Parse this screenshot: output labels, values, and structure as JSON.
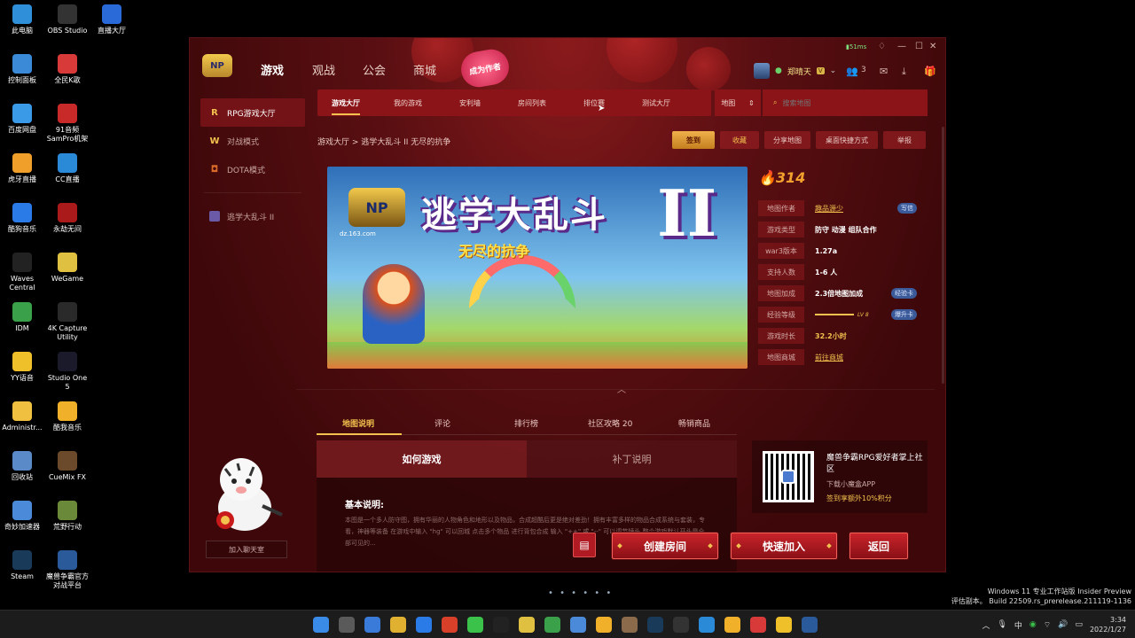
{
  "desktop": {
    "icons": [
      {
        "label": "此电脑",
        "icon": "computer-icon",
        "color": "#2f8fd8"
      },
      {
        "label": "OBS Studio",
        "icon": "obs-icon",
        "color": "#333333"
      },
      {
        "label": "直播大厅",
        "icon": "live-hall-icon",
        "color": "#2a6ad8"
      },
      {
        "label": "控制面板",
        "icon": "control-panel-icon",
        "color": "#3a8ad8"
      },
      {
        "label": "全民K歌",
        "icon": "kge-icon",
        "color": "#d83a3a"
      },
      {
        "label": "百度网盘",
        "icon": "baidu-pan-icon",
        "color": "#3a9ae8"
      },
      {
        "label": "91音频 SamPro机架",
        "icon": "sampro-icon",
        "color": "#c82a2a"
      },
      {
        "label": "虎牙直播",
        "icon": "huya-icon",
        "color": "#f0a02a"
      },
      {
        "label": "CC直播",
        "icon": "cc-icon",
        "color": "#2a8ad8"
      },
      {
        "label": "酷狗音乐",
        "icon": "kugou-icon",
        "color": "#2a7ae8"
      },
      {
        "label": "永劫无间",
        "icon": "naraka-icon",
        "color": "#aa1a1a"
      },
      {
        "label": "Waves Central",
        "icon": "waves-icon",
        "color": "#222222"
      },
      {
        "label": "WeGame",
        "icon": "wegame-icon",
        "color": "#e0c040"
      },
      {
        "label": "IDM",
        "icon": "idm-icon",
        "color": "#3aa04a"
      },
      {
        "label": "4K Capture Utility",
        "icon": "capture-icon",
        "color": "#2a2a2a"
      },
      {
        "label": "YY语音",
        "icon": "yy-icon",
        "color": "#f0c02a"
      },
      {
        "label": "Studio One 5",
        "icon": "studio-one-icon",
        "color": "#1a1a2a"
      },
      {
        "label": "Administr...",
        "icon": "folder-icon",
        "color": "#f0c040"
      },
      {
        "label": "酷我音乐",
        "icon": "kuwo-icon",
        "color": "#f0b02a"
      },
      {
        "label": "回收站",
        "icon": "recycle-bin-icon",
        "color": "#5a8ac8"
      },
      {
        "label": "CueMix FX",
        "icon": "cuemix-icon",
        "color": "#6a4a2a"
      },
      {
        "label": "奇妙加速器",
        "icon": "accelerator-icon",
        "color": "#4a8ad8"
      },
      {
        "label": "荒野行动",
        "icon": "knives-out-icon",
        "color": "#6a8a3a"
      },
      {
        "label": "Steam",
        "icon": "steam-icon",
        "color": "#1a3a5a"
      },
      {
        "label": "魔兽争霸官方对战平台",
        "icon": "warcraft-platform-icon",
        "color": "#2a5a9a"
      }
    ],
    "watermark_line1": "Windows 11 专业工作站版 Insider Preview",
    "watermark_line2": "评估副本。 Build 22509.rs_prerelease.211119-1136"
  },
  "taskbar": {
    "tray_lang": "中",
    "time": "3:34",
    "date": "2022/1/27"
  },
  "app": {
    "ping": "51ms",
    "nav": [
      "游戏",
      "观战",
      "公会",
      "商城"
    ],
    "author_badge": "成为作者",
    "username": "郑晴天",
    "vip": "V",
    "friends_count": "3",
    "sidebar": [
      {
        "label": "RPG游戏大厅",
        "icon": "rpg-icon"
      },
      {
        "label": "对战模式",
        "icon": "battle-mode-icon"
      },
      {
        "label": "DOTA模式",
        "icon": "dota-icon"
      },
      {
        "label": "逃学大乱斗 II",
        "icon": "game-thumb-icon"
      }
    ],
    "chat_button": "加入聊天室",
    "subtabs": [
      "游戏大厅",
      "我的游戏",
      "安利墙",
      "房间列表",
      "排位赛",
      "测试大厅"
    ],
    "map_select": "地图",
    "search_placeholder": "搜索地图",
    "breadcrumb": "游戏大厅 > 逃学大乱斗 II 无尽的抗争",
    "actions": [
      "签到",
      "收藏",
      "分享地图",
      "桌面快捷方式",
      "举报"
    ],
    "banner": {
      "title": "逃学大乱斗",
      "numeral": "II",
      "subtitle": "无尽的抗争",
      "site": "dz.163.com",
      "logo_text": "NP"
    },
    "heat": "314",
    "info": [
      {
        "key": "地图作者",
        "value": "趣品源少",
        "style": "link",
        "pill": "写信"
      },
      {
        "key": "游戏类型",
        "value": "防守 动漫 组队合作",
        "style": "bold",
        "pill": ""
      },
      {
        "key": "war3版本",
        "value": "1.27a",
        "style": "bold",
        "pill": ""
      },
      {
        "key": "支持人数",
        "value": "1-6 人",
        "style": "bold",
        "pill": ""
      },
      {
        "key": "地图加成",
        "value": "2.3倍地图加成",
        "style": "bold",
        "pill": "经验卡"
      },
      {
        "key": "经验等级",
        "value": "LV 8",
        "style": "exp",
        "pill": "爆升卡"
      },
      {
        "key": "游戏时长",
        "value": "32.2小时",
        "style": "gold",
        "pill": ""
      },
      {
        "key": "地图商城",
        "value": "前往商城",
        "style": "link",
        "pill": ""
      }
    ],
    "content_tabs": [
      "地图说明",
      "评论",
      "排行榜",
      "社区攻略 20",
      "畅销商品"
    ],
    "howto": {
      "tabs": [
        "如何游戏",
        "补丁说明"
      ],
      "heading": "基本说明:",
      "text": "本图是一个多人防守图，拥有华丽的人物角色和地形以及物品，合成超酷后更是绝对差劲！拥有丰富多样的物品合成系统与套装，专看，神器等装备 在游戏中输入 \"hg\" 可以回城 点击多个物品 进行背包合成 输入 \"++\" 或 \"--\" 可以调节镜头 整个游戏默认开头是全部可见的..."
    },
    "qr_card": {
      "title": "魔兽争霸RPG爱好者掌上社区",
      "subtitle": "下载小魔盒APP",
      "bonus": "签到享额外10%积分"
    },
    "bottom_buttons": [
      "创建房间",
      "快速加入",
      "返回"
    ]
  }
}
